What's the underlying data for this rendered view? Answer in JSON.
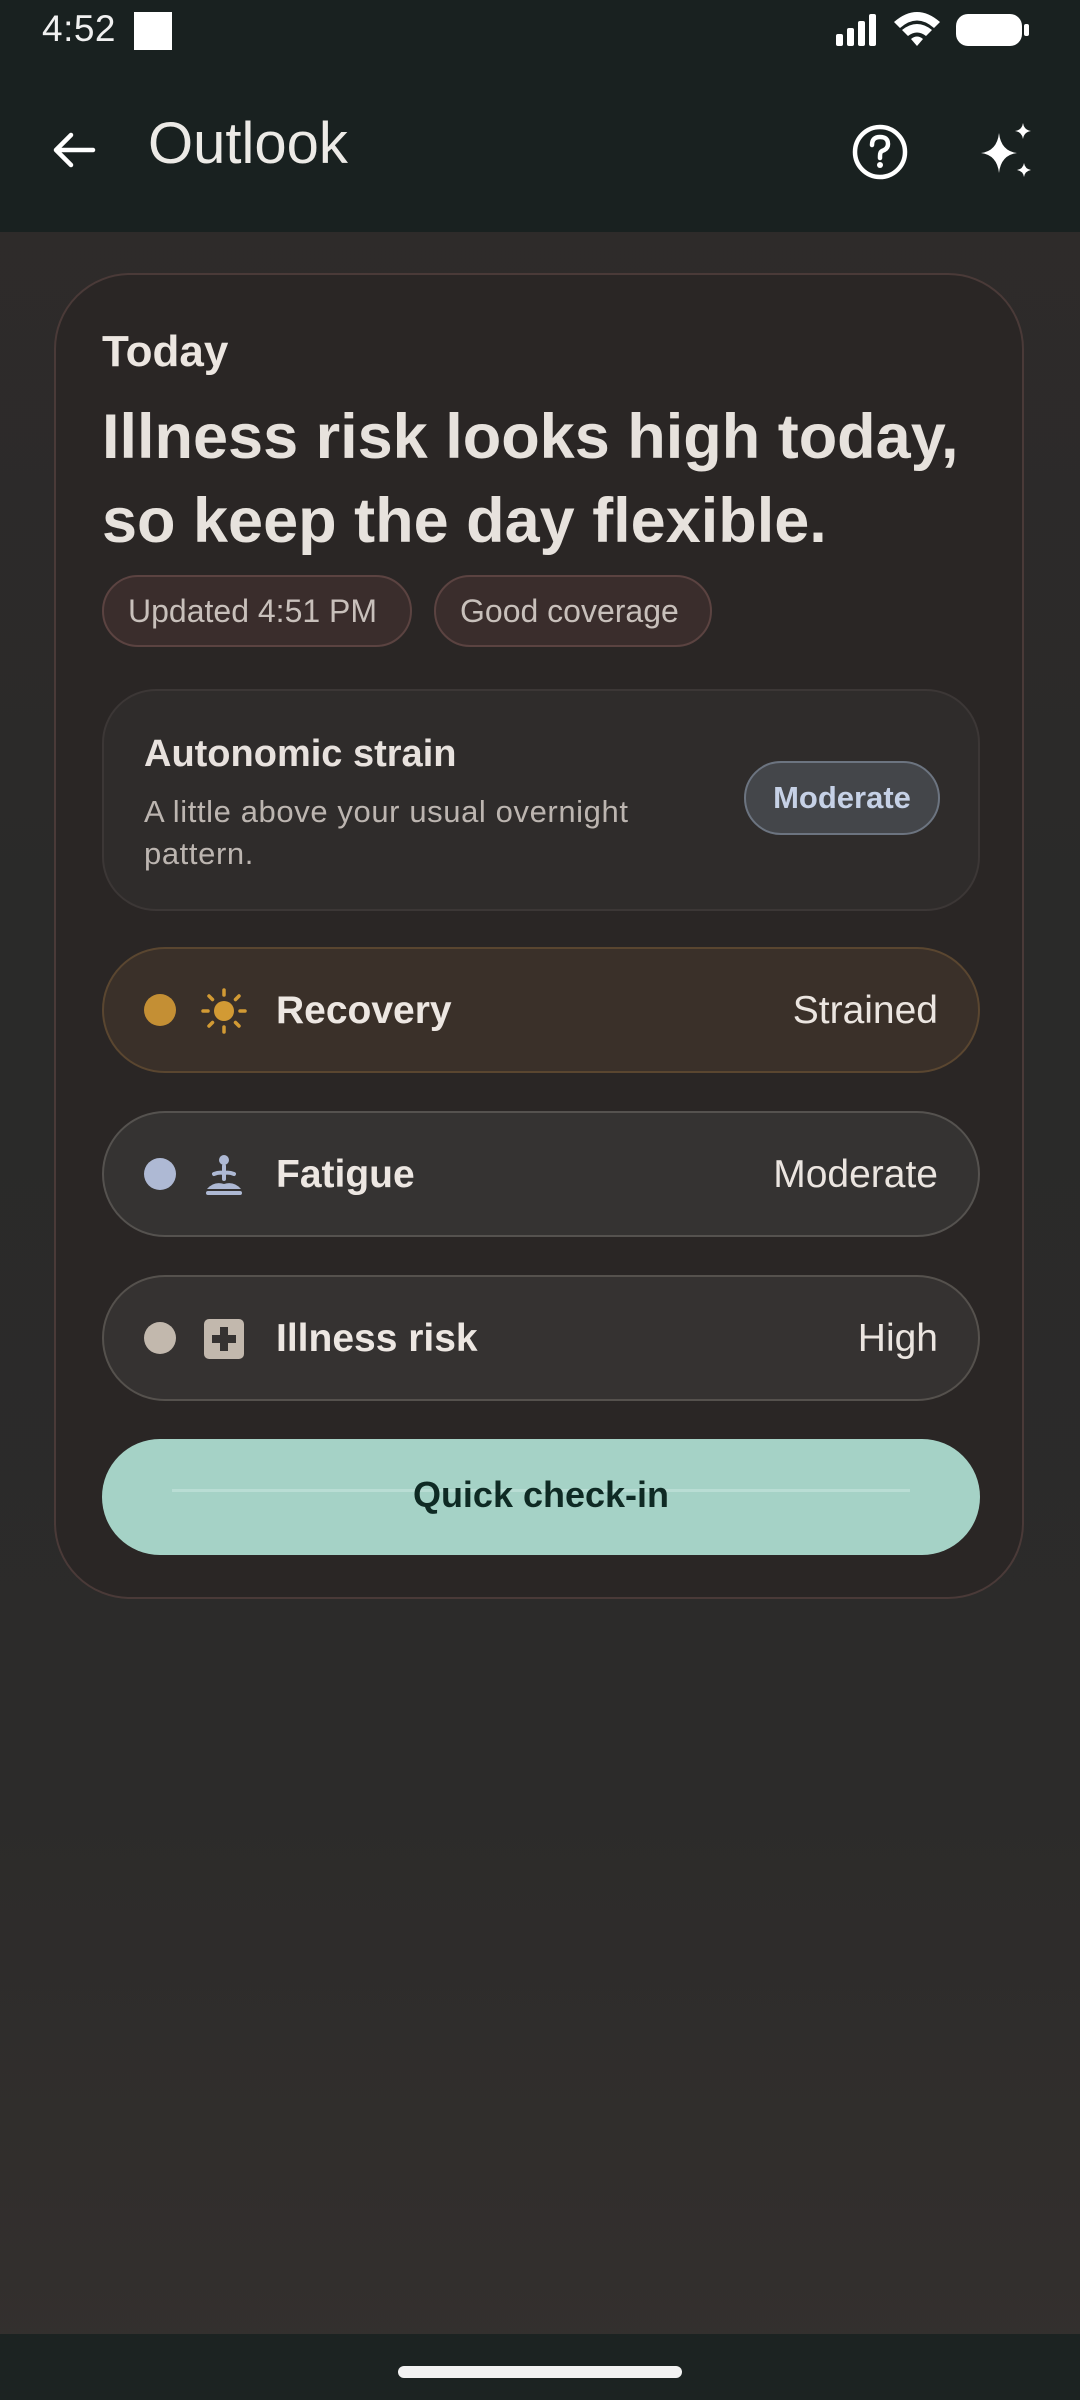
{
  "status_bar": {
    "time": "4:52"
  },
  "app_bar": {
    "title": "Outlook",
    "back_icon": "arrow-left-icon",
    "help_icon": "help-circle-icon",
    "assistant_icon": "sparkle-icon"
  },
  "card": {
    "eyebrow": "Today",
    "headline": "Illness risk looks high today, so keep the day flexible.",
    "chips": [
      {
        "label": "Updated 4:51 PM"
      },
      {
        "label": "Good coverage"
      }
    ],
    "strain": {
      "title": "Autonomic strain",
      "description": "A little above your usual overnight pattern.",
      "badge": "Moderate"
    },
    "metrics": [
      {
        "label": "Recovery",
        "value": "Strained",
        "icon": "sun-icon",
        "dot_color": "#c48f34"
      },
      {
        "label": "Fatigue",
        "value": "Moderate",
        "icon": "meditation-icon",
        "dot_color": "#aeb9d4"
      },
      {
        "label": "Illness risk",
        "value": "High",
        "icon": "medical-cross-icon",
        "dot_color": "#c2b8ad"
      }
    ],
    "checkin_label": "Quick check-in"
  },
  "colors": {
    "bar_background": "#192120",
    "accent_button": "#a5d2c6",
    "recovery_accent": "#c48f34"
  }
}
